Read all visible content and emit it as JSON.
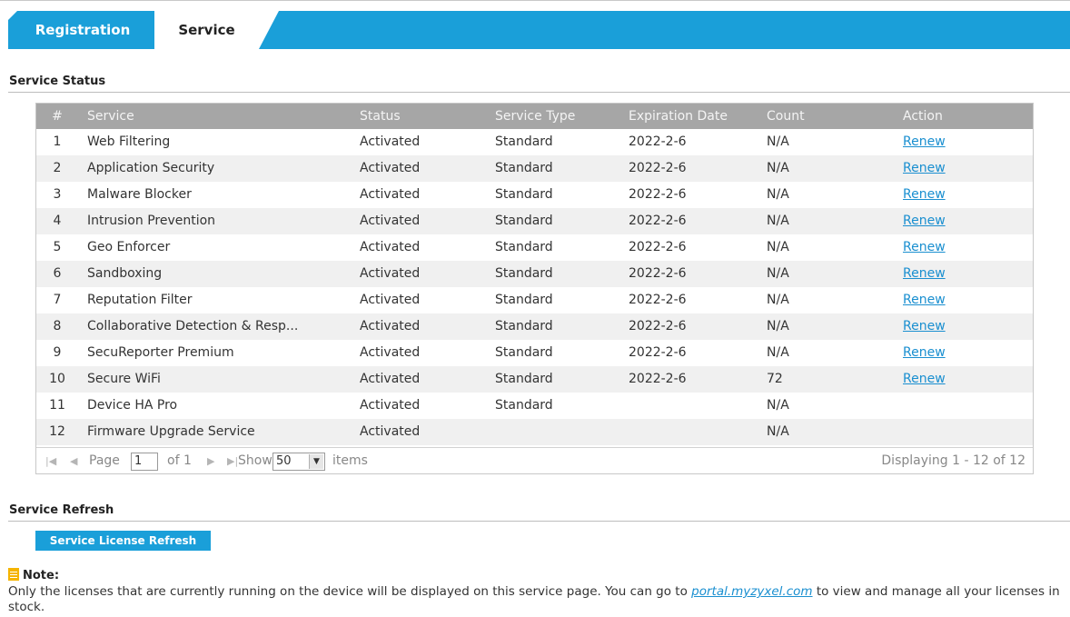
{
  "tabs": [
    {
      "label": "Registration"
    },
    {
      "label": "Service"
    }
  ],
  "service_status": {
    "title": "Service Status",
    "columns": [
      "#",
      "Service",
      "Status",
      "Service Type",
      "Expiration Date",
      "Count",
      "Action"
    ],
    "rows": [
      {
        "num": "1",
        "service": "Web Filtering",
        "status": "Activated",
        "type": "Standard",
        "expiration": "2022-2-6",
        "count": "N/A",
        "action": "Renew"
      },
      {
        "num": "2",
        "service": "Application Security",
        "status": "Activated",
        "type": "Standard",
        "expiration": "2022-2-6",
        "count": "N/A",
        "action": "Renew"
      },
      {
        "num": "3",
        "service": "Malware Blocker",
        "status": "Activated",
        "type": "Standard",
        "expiration": "2022-2-6",
        "count": "N/A",
        "action": "Renew"
      },
      {
        "num": "4",
        "service": "Intrusion Prevention",
        "status": "Activated",
        "type": "Standard",
        "expiration": "2022-2-6",
        "count": "N/A",
        "action": "Renew"
      },
      {
        "num": "5",
        "service": "Geo Enforcer",
        "status": "Activated",
        "type": "Standard",
        "expiration": "2022-2-6",
        "count": "N/A",
        "action": "Renew"
      },
      {
        "num": "6",
        "service": "Sandboxing",
        "status": "Activated",
        "type": "Standard",
        "expiration": "2022-2-6",
        "count": "N/A",
        "action": "Renew"
      },
      {
        "num": "7",
        "service": "Reputation Filter",
        "status": "Activated",
        "type": "Standard",
        "expiration": "2022-2-6",
        "count": "N/A",
        "action": "Renew"
      },
      {
        "num": "8",
        "service": "Collaborative Detection & Resp...",
        "status": "Activated",
        "type": "Standard",
        "expiration": "2022-2-6",
        "count": "N/A",
        "action": "Renew"
      },
      {
        "num": "9",
        "service": "SecuReporter Premium",
        "status": "Activated",
        "type": "Standard",
        "expiration": "2022-2-6",
        "count": "N/A",
        "action": "Renew"
      },
      {
        "num": "10",
        "service": "Secure WiFi",
        "status": "Activated",
        "type": "Standard",
        "expiration": "2022-2-6",
        "count": "72",
        "action": "Renew"
      },
      {
        "num": "11",
        "service": "Device HA Pro",
        "status": "Activated",
        "type": "Standard",
        "expiration": "",
        "count": "N/A",
        "action": ""
      },
      {
        "num": "12",
        "service": "Firmware Upgrade Service",
        "status": "Activated",
        "type": "",
        "expiration": "",
        "count": "N/A",
        "action": ""
      }
    ],
    "pager": {
      "page_label": "Page",
      "page_value": "1",
      "of_label": "of 1",
      "show_label": "Show",
      "show_value": "50",
      "items_label": "items",
      "displaying": "Displaying 1 - 12 of 12",
      "icons": [
        "first-page-icon",
        "prev-page-icon",
        "next-page-icon",
        "last-page-icon"
      ]
    }
  },
  "service_refresh": {
    "title": "Service Refresh",
    "button_label": "Service License Refresh"
  },
  "note": {
    "label": "Note:",
    "text_before": "Only the licenses that are currently running on the device will be displayed on this service page. You can go to ",
    "link": "portal.myzyxel.com",
    "text_after": " to view and manage all your licenses in stock."
  },
  "colors": {
    "accent": "#1a9fd9",
    "header_gray": "#a6a6a6",
    "link": "#1a8fd0",
    "note_icon": "#f5b400"
  }
}
